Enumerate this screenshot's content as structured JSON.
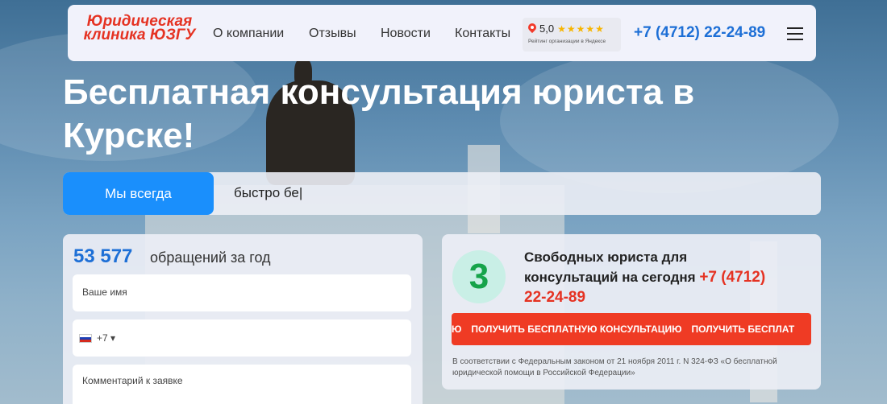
{
  "header": {
    "logo_text": "Юридическая клиника ЮЗГУ",
    "nav": [
      "О компании",
      "Отзывы",
      "Новости",
      "Контакты"
    ],
    "rating": {
      "score": "5,0",
      "stars": "★★★★★",
      "caption": "Рейтинг организации в Яндексе"
    },
    "phone": "+7 (4712) 22-24-89"
  },
  "hero": {
    "title": "Бесплатная консультация юриста в Курске!"
  },
  "tabs": {
    "active_label": "Мы всегда",
    "typing_text": "быстро бе|"
  },
  "form": {
    "count_value": "53 577",
    "count_label": "обращений за год",
    "name_placeholder": "Ваше имя",
    "phone_prefix": "+7 ▾",
    "comment_placeholder": "Комментарий к заявке"
  },
  "info": {
    "free_count": "3",
    "text": "Свободных юриста для консультаций на сегодня",
    "phone": "+7 (4712) 22-24-89",
    "cta_fragment": "Ю",
    "cta_label": "Получить бесплатную консультацию",
    "cta_repeat": "Получить бесплат",
    "law_text": "В соответствии с Федеральным законом от 21 ноября 2011 г. N 324-ФЗ «О бесплатной юридической помощи в Российской Федерации»"
  },
  "colors": {
    "brand_red": "#e53222",
    "accent_blue": "#1d6fd6",
    "tab_blue": "#1a8ffc",
    "cta_red": "#ef3b24",
    "count_green": "#16a34a"
  }
}
